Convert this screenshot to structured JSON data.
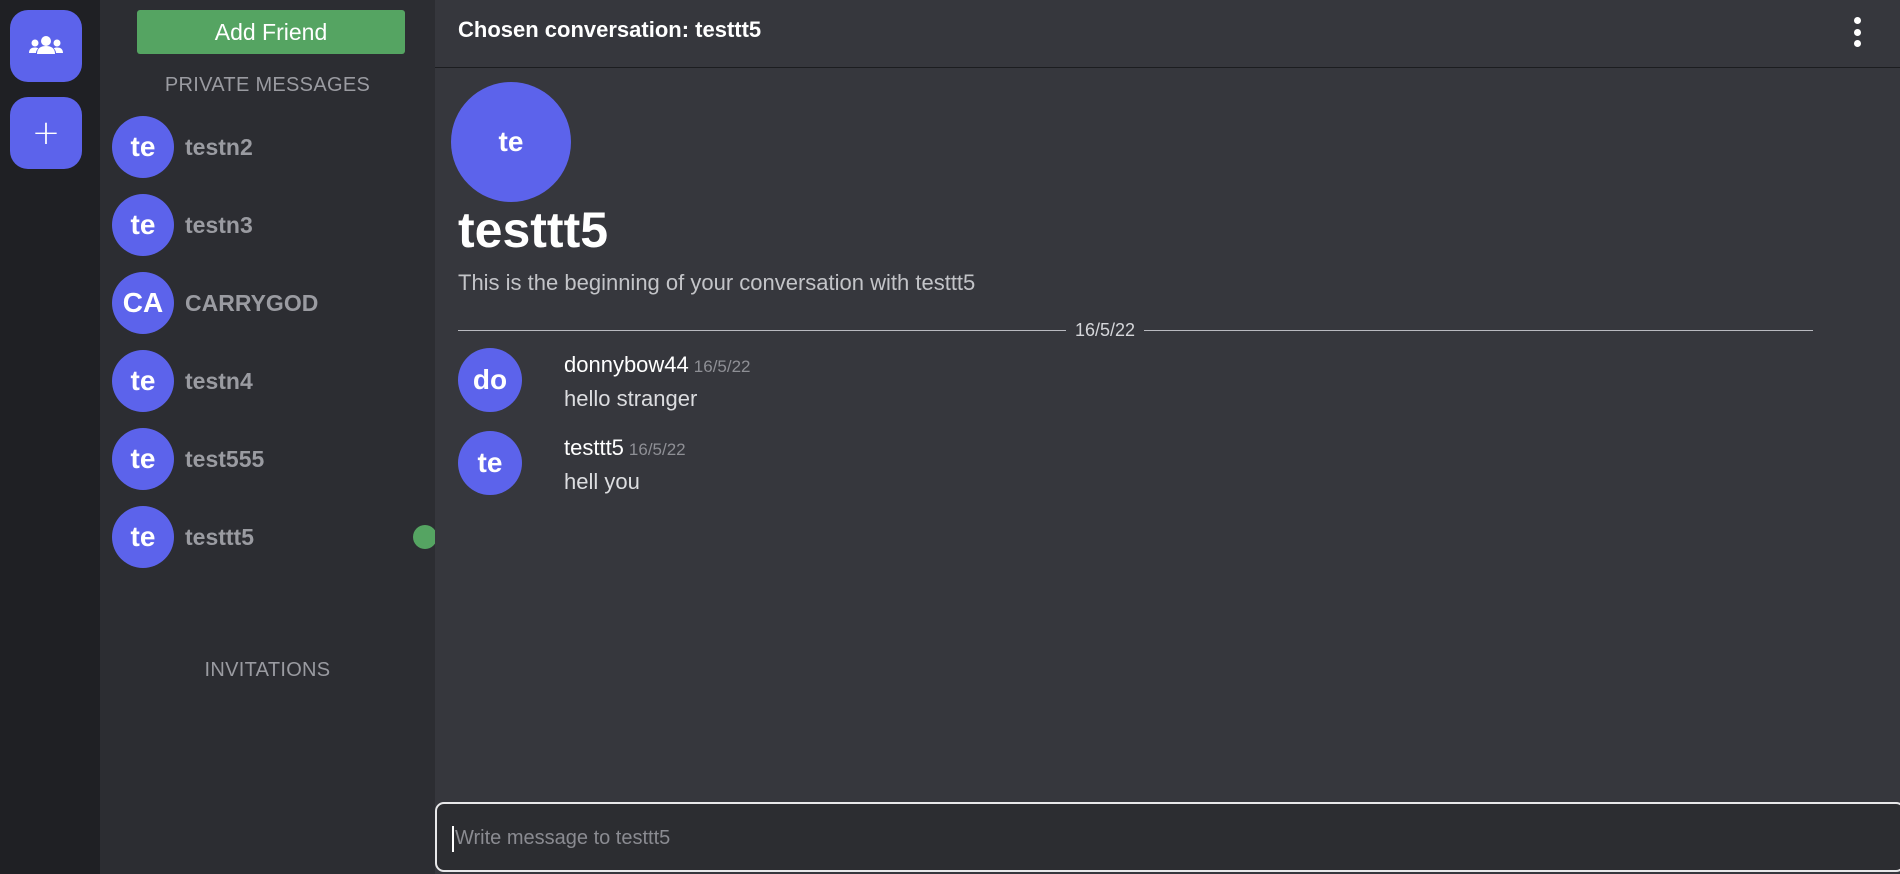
{
  "rail": {
    "friends_icon": "people-group-icon",
    "add_icon": "plus-icon",
    "add_symbol": "+",
    "accent": "#5c63eb"
  },
  "sidebar": {
    "add_friend_label": "Add Friend",
    "private_messages_title": "PRIVATE MESSAGES",
    "invitations_title": "INVITATIONS",
    "dms": [
      {
        "initials": "te",
        "name": "testn2",
        "online": false
      },
      {
        "initials": "te",
        "name": "testn3",
        "online": false
      },
      {
        "initials": "CA",
        "name": "CARRYGOD",
        "online": false
      },
      {
        "initials": "te",
        "name": "testn4",
        "online": false
      },
      {
        "initials": "te",
        "name": "test555",
        "online": false
      },
      {
        "initials": "te",
        "name": "testtt5",
        "online": true
      }
    ],
    "online_color": "#55a462"
  },
  "header": {
    "title": "Chosen conversation: testtt5",
    "menu_icon": "kebab-menu-icon"
  },
  "conversation": {
    "avatar_initials": "te",
    "name": "testtt5",
    "intro": "This is the beginning of your conversation with testtt5",
    "date_divider": "16/5/22",
    "messages": [
      {
        "initials": "do",
        "author": "donnybow44",
        "time": "16/5/22",
        "text": "hello stranger"
      },
      {
        "initials": "te",
        "author": "testtt5",
        "time": "16/5/22",
        "text": "hell you"
      }
    ]
  },
  "composer": {
    "placeholder": "Write message to testtt5",
    "value": ""
  }
}
